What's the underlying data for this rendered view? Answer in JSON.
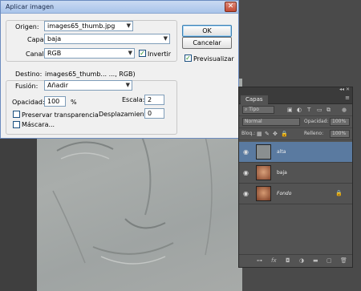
{
  "dialog": {
    "title": "Aplicar imagen",
    "close_icon": "close-icon",
    "origen": {
      "label": "Origen:",
      "value": "images65_thumb.jpg"
    },
    "capa": {
      "label": "Capa:",
      "value": "baja"
    },
    "canal": {
      "label": "Canal:",
      "value": "RGB"
    },
    "invertir": {
      "label": "Invertir",
      "checked": true
    },
    "destino": {
      "label": "Destino:",
      "value": "images65_thumb... ..., RGB)"
    },
    "fusion": {
      "label": "Fusión:",
      "value": "Añadir"
    },
    "opacidad": {
      "label": "Opacidad:",
      "value": "100",
      "unit": "%"
    },
    "escala": {
      "label": "Escala:",
      "value": "2"
    },
    "preservar": {
      "label": "Preservar transparencia",
      "checked": false
    },
    "desplazamiento": {
      "label": "Desplazamiento:",
      "value": "0"
    },
    "mascara": {
      "label": "Máscara...",
      "checked": false
    },
    "ok_label": "OK",
    "cancel_label": "Cancelar",
    "previsualizar": {
      "label": "Previsualizar",
      "checked": true
    }
  },
  "panel": {
    "tab": "Capas",
    "filter_label": "Tipo",
    "blend_mode": "Normal",
    "opacity_label": "Opacidad:",
    "opacity_value": "100%",
    "lock_label": "Bloq.:",
    "fill_label": "Relleno:",
    "fill_value": "100%",
    "layers": [
      {
        "name": "alta",
        "active": true,
        "thumb_color": "#8a8f90"
      },
      {
        "name": "baja",
        "active": false,
        "thumb_color": "#b06a4a"
      },
      {
        "name": "Fondo",
        "active": false,
        "thumb_color": "#a65a3e"
      }
    ],
    "bottom_icons": [
      "link-icon",
      "fx-icon",
      "mask-icon",
      "adjustment-icon",
      "folder-icon",
      "new-layer-icon",
      "trash-icon"
    ]
  }
}
